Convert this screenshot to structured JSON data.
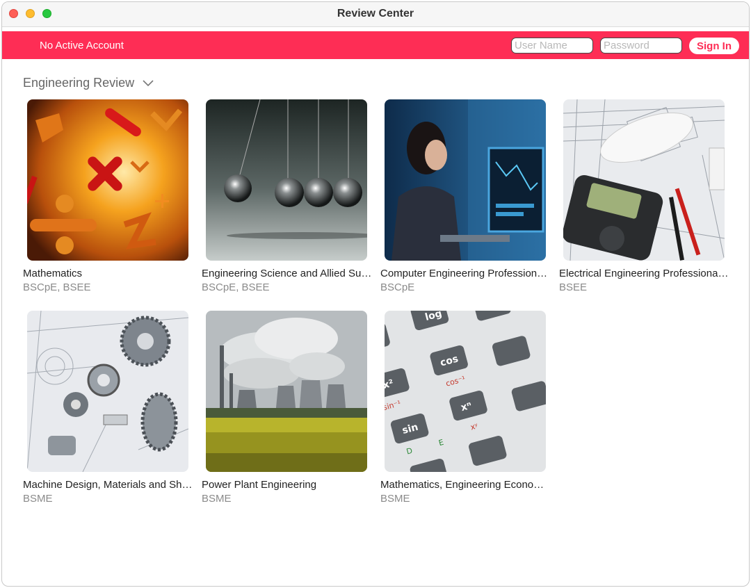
{
  "window": {
    "title": "Review Center"
  },
  "account": {
    "status": "No Active Account",
    "username_placeholder": "User Name",
    "password_placeholder": "Password",
    "signin_label": "Sign In",
    "accent": "#fe2d55"
  },
  "section": {
    "title": "Engineering Review"
  },
  "courses": [
    {
      "title": "Mathematics",
      "programs": "BSCpE, BSEE",
      "icon": "math-symbols-image"
    },
    {
      "title": "Engineering Science and Allied Subjects",
      "programs": "BSCpE, BSEE",
      "icon": "newtons-cradle-image"
    },
    {
      "title": "Computer Engineering Professional Subjects",
      "programs": "BSCpE",
      "icon": "computer-engineer-image"
    },
    {
      "title": "Electrical Engineering Professional Subjects",
      "programs": "BSEE",
      "icon": "multimeter-image"
    },
    {
      "title": "Machine Design, Materials and Shop Practice",
      "programs": "BSME",
      "icon": "machine-parts-image"
    },
    {
      "title": "Power Plant Engineering",
      "programs": "BSME",
      "icon": "power-plant-image"
    },
    {
      "title": "Mathematics, Engineering Economics and Basic Engineering Sciences",
      "programs": "BSME",
      "icon": "calculator-image"
    }
  ]
}
